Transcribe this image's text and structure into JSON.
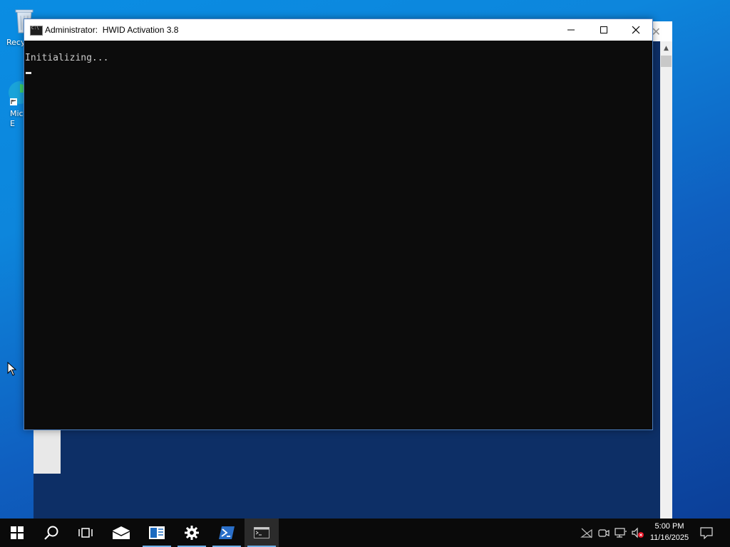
{
  "desktop": {
    "icons": [
      {
        "label": "Recy",
        "name": "recycle-bin"
      },
      {
        "label": "Mic\nE",
        "name": "microsoft-edge"
      }
    ]
  },
  "console": {
    "title_prefix": "Administrator:",
    "title": "HWID Activation 3.8",
    "output_lines": [
      "Initializing..."
    ],
    "icon": "cmd-icon"
  },
  "taskbar": {
    "buttons": [
      {
        "name": "start-button",
        "icon": "windows-logo-icon"
      },
      {
        "name": "search-button",
        "icon": "search-icon"
      },
      {
        "name": "task-view-button",
        "icon": "task-view-icon"
      },
      {
        "name": "mail-button",
        "icon": "mail-icon"
      },
      {
        "name": "news-button",
        "icon": "news-icon"
      },
      {
        "name": "settings-button",
        "icon": "gear-icon"
      },
      {
        "name": "powershell-button",
        "icon": "powershell-icon"
      },
      {
        "name": "cmd-button",
        "icon": "cmd-icon"
      }
    ],
    "tray": [
      "network-disconnected-icon",
      "meet-now-icon",
      "network-icon",
      "volume-muted-icon"
    ],
    "clock": {
      "time": "5:00 PM",
      "date": "11/16/2025"
    }
  },
  "colors": {
    "accent": "#0078d7",
    "console_bg": "#0c0c0c",
    "console_text": "#cccccc"
  }
}
